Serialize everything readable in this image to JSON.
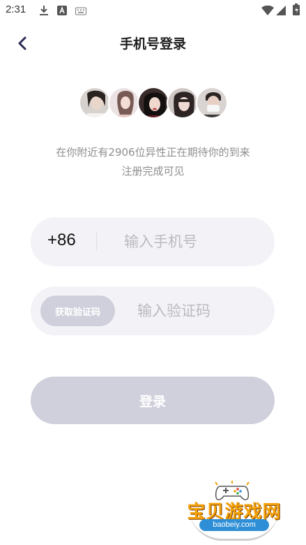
{
  "status_bar": {
    "time": "2:31",
    "icons": [
      "download-icon",
      "a-badge-icon",
      "keyboard-icon",
      "wifi-icon",
      "signal-icon",
      "battery-icon"
    ]
  },
  "header": {
    "back_icon": "chevron-left-icon",
    "title": "手机号登录"
  },
  "avatars": [
    "avatar-1",
    "avatar-2",
    "avatar-3",
    "avatar-4",
    "avatar-5"
  ],
  "nearby": {
    "line1": "在你附近有2906位异性正在期待你的到来",
    "line2": "注册完成可见"
  },
  "phone": {
    "country_code": "+86",
    "placeholder": "输入手机号",
    "value": ""
  },
  "code": {
    "get_code_label": "获取验证码",
    "placeholder": "输入验证码",
    "value": ""
  },
  "login": {
    "label": "登录"
  },
  "watermark": {
    "name": "宝贝游戏网",
    "url": "baobeiy.com"
  },
  "colors": {
    "button_disabled": "#d0d0dc",
    "input_background": "#f3f3f7",
    "hint_text": "#8e8e8e",
    "placeholder": "#b9b9c0"
  }
}
